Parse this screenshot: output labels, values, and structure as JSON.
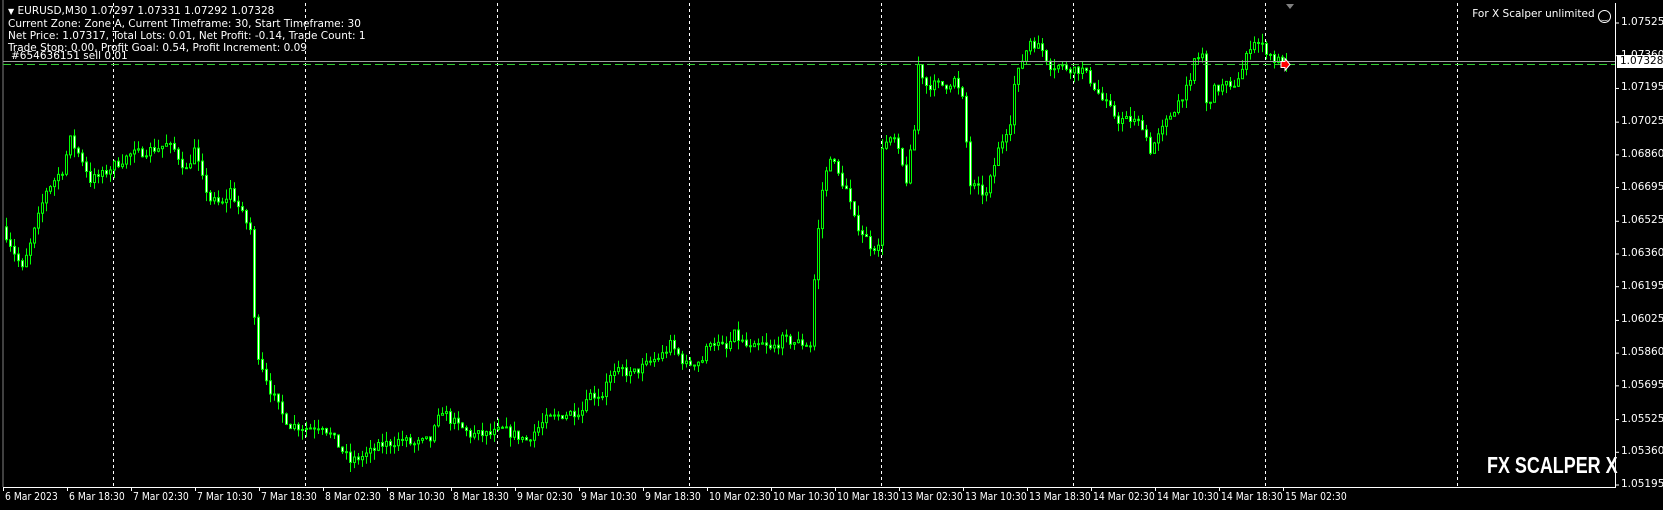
{
  "header": {
    "symbol_line": "EURUSD,M30  1.07297 1.07331 1.07292 1.07328",
    "zone_line": "Current Zone: Zone A, Current Timeframe: 30, Start Timeframe: 30",
    "net_line": "Net Price: 1.07317, Total Lots: 0.01, Net Profit: -0.14, Trade Count: 1",
    "stop_line": "Trade Stop: 0.00, Profit Goal: 0.54, Profit Increment: 0.09",
    "order_line": "#654636151 sell 0.01"
  },
  "ea_status": "For X Scalper unlimited",
  "ea_status_icon": "smiley-icon",
  "brand_watermark": "FX SCALPER X",
  "current_price": "1.07328",
  "colors": {
    "bull": "#00ff00",
    "bear_fill": "#ffffff",
    "background": "#000000",
    "grid": "#ffffff",
    "order_line": "#32cd32",
    "price_line": "#a0a0a0",
    "marker": "#ff0000"
  },
  "chart_data": {
    "type": "candlestick",
    "symbol": "EURUSD",
    "timeframe": "M30",
    "ylim": [
      1.05195,
      1.07525
    ],
    "y_ticks": [
      "1.07525",
      "1.07360",
      "1.07195",
      "1.07025",
      "1.06860",
      "1.06695",
      "1.06525",
      "1.06360",
      "1.06195",
      "1.06025",
      "1.05860",
      "1.05695",
      "1.05525",
      "1.05360",
      "1.05195"
    ],
    "x_ticks": [
      "6 Mar 2023",
      "6 Mar 18:30",
      "7 Mar 02:30",
      "7 Mar 10:30",
      "7 Mar 18:30",
      "8 Mar 02:30",
      "8 Mar 10:30",
      "8 Mar 18:30",
      "9 Mar 02:30",
      "9 Mar 10:30",
      "9 Mar 18:30",
      "10 Mar 02:30",
      "10 Mar 10:30",
      "10 Mar 18:30",
      "13 Mar 02:30",
      "13 Mar 10:30",
      "13 Mar 18:30",
      "14 Mar 02:30",
      "14 Mar 10:30",
      "14 Mar 18:30",
      "15 Mar 02:30"
    ],
    "bars_per_tick": 16,
    "bar_count": 321,
    "close_keypoints": [
      [
        0,
        1.06457
      ],
      [
        4,
        1.0628
      ],
      [
        6,
        1.06406
      ],
      [
        10,
        1.06683
      ],
      [
        14,
        1.06784
      ],
      [
        16,
        1.06935
      ],
      [
        19,
        1.06835
      ],
      [
        21,
        1.06734
      ],
      [
        24,
        1.06759
      ],
      [
        27,
        1.06809
      ],
      [
        31,
        1.0686
      ],
      [
        36,
        1.06885
      ],
      [
        40,
        1.0691
      ],
      [
        42,
        1.06885
      ],
      [
        45,
        1.06784
      ],
      [
        47,
        1.06885
      ],
      [
        49,
        1.06734
      ],
      [
        51,
        1.06633
      ],
      [
        54,
        1.06608
      ],
      [
        56,
        1.06683
      ],
      [
        59,
        1.06557
      ],
      [
        61,
        1.06482
      ],
      [
        62,
        1.06028
      ],
      [
        63,
        1.05852
      ],
      [
        66,
        1.05675
      ],
      [
        69,
        1.05549
      ],
      [
        71,
        1.05499
      ],
      [
        75,
        1.05484
      ],
      [
        79,
        1.05499
      ],
      [
        82,
        1.05423
      ],
      [
        86,
        1.05312
      ],
      [
        90,
        1.05348
      ],
      [
        94,
        1.05398
      ],
      [
        99,
        1.05423
      ],
      [
        102,
        1.05398
      ],
      [
        106,
        1.05423
      ],
      [
        109,
        1.05575
      ],
      [
        111,
        1.05524
      ],
      [
        116,
        1.05449
      ],
      [
        121,
        1.05449
      ],
      [
        124,
        1.05474
      ],
      [
        130,
        1.05423
      ],
      [
        135,
        1.05524
      ],
      [
        139,
        1.05549
      ],
      [
        144,
        1.05575
      ],
      [
        145,
        1.0565
      ],
      [
        149,
        1.0565
      ],
      [
        150,
        1.05726
      ],
      [
        154,
        1.05776
      ],
      [
        156,
        1.05751
      ],
      [
        160,
        1.05801
      ],
      [
        164,
        1.05852
      ],
      [
        166,
        1.05902
      ],
      [
        170,
        1.05801
      ],
      [
        174,
        1.05827
      ],
      [
        176,
        1.05927
      ],
      [
        180,
        1.05877
      ],
      [
        182,
        1.05952
      ],
      [
        186,
        1.05877
      ],
      [
        189,
        1.05902
      ],
      [
        191,
        1.05877
      ],
      [
        194,
        1.05927
      ],
      [
        201,
        1.05902
      ],
      [
        202,
        1.0623
      ],
      [
        203,
        1.06482
      ],
      [
        204,
        1.06683
      ],
      [
        206,
        1.0686
      ],
      [
        208,
        1.06759
      ],
      [
        210,
        1.06683
      ],
      [
        212,
        1.06532
      ],
      [
        216,
        1.06406
      ],
      [
        218,
        1.06391
      ],
      [
        219,
        1.0691
      ],
      [
        222,
        1.06935
      ],
      [
        225,
        1.06734
      ],
      [
        227,
        1.06986
      ],
      [
        228,
        1.07313
      ],
      [
        230,
        1.07213
      ],
      [
        235,
        1.07213
      ],
      [
        237,
        1.07238
      ],
      [
        239,
        1.07137
      ],
      [
        241,
        1.06709
      ],
      [
        245,
        1.06658
      ],
      [
        248,
        1.06885
      ],
      [
        251,
        1.07036
      ],
      [
        252,
        1.07213
      ],
      [
        254,
        1.07339
      ],
      [
        256,
        1.07439
      ],
      [
        259,
        1.07389
      ],
      [
        261,
        1.07313
      ],
      [
        266,
        1.07298
      ],
      [
        269,
        1.07288
      ],
      [
        271,
        1.07238
      ],
      [
        274,
        1.07137
      ],
      [
        278,
        1.07036
      ],
      [
        281,
        1.07036
      ],
      [
        284,
        1.07011
      ],
      [
        286,
        1.06885
      ],
      [
        289,
        1.06986
      ],
      [
        291,
        1.07061
      ],
      [
        294,
        1.07162
      ],
      [
        296,
        1.07213
      ],
      [
        297,
        1.07339
      ],
      [
        299,
        1.07364
      ],
      [
        300,
        1.07112
      ],
      [
        302,
        1.07187
      ],
      [
        305,
        1.07213
      ],
      [
        306,
        1.07187
      ],
      [
        309,
        1.07288
      ],
      [
        311,
        1.07414
      ],
      [
        312,
        1.07439
      ],
      [
        315,
        1.07389
      ],
      [
        317,
        1.07339
      ],
      [
        320,
        1.07328
      ]
    ],
    "current_price": 1.07328,
    "order_price": 1.07317,
    "grid": "vertical-dashed"
  }
}
